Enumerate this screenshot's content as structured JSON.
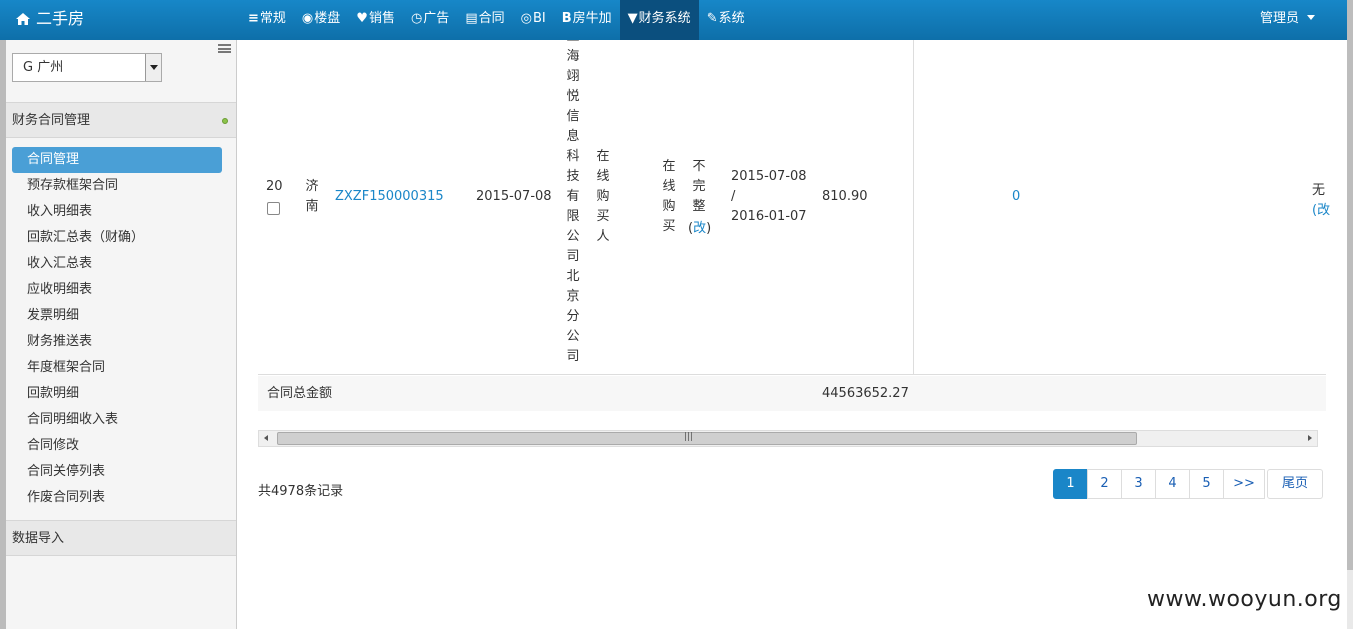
{
  "topbar": {
    "brand": "二手房",
    "nav": [
      {
        "icon": "≡",
        "label": "常规"
      },
      {
        "icon": "◉",
        "label": "楼盘"
      },
      {
        "icon": "♥",
        "label": "销售"
      },
      {
        "icon": "◷",
        "label": "广告"
      },
      {
        "icon": "▤",
        "label": "合同"
      },
      {
        "icon": "◎",
        "label": "BI"
      },
      {
        "icon": "B",
        "label": "房牛加"
      },
      {
        "icon": "▼",
        "label": "财务系统"
      },
      {
        "icon": "✎",
        "label": "系统"
      }
    ],
    "active_nav": "财务系统",
    "user": "管理员"
  },
  "sidebar": {
    "city_select": "G 广州",
    "section1": "财务合同管理",
    "menu": [
      "合同管理",
      "预存款框架合同",
      "收入明细表",
      "回款汇总表（财确）",
      "收入汇总表",
      "应收明细表",
      "发票明细",
      "财务推送表",
      "年度框架合同",
      "回款明细",
      "合同明细收入表",
      "合同修改",
      "合同关停列表",
      "作废合同列表"
    ],
    "active_menu": "合同管理",
    "section2": "数据导入"
  },
  "row": {
    "index": "20",
    "city": [
      "济",
      "南"
    ],
    "contract_no": "ZXZF150000315",
    "date": "2015-07-08",
    "company": [
      "上",
      "海",
      "翊",
      "悦",
      "信",
      "息",
      "科",
      "技",
      "有",
      "限",
      "公",
      "司",
      "北",
      "京",
      "分",
      "公",
      "司"
    ],
    "buyer_type": [
      "在",
      "线",
      "购",
      "买",
      "人"
    ],
    "channel": [
      "在",
      "线",
      "购",
      "买"
    ],
    "status": [
      "不",
      "完",
      "整"
    ],
    "edit_paren_open": "(",
    "edit_link": "改",
    "edit_paren_close": ")",
    "period_start": "2015-07-08",
    "period_sep": "/",
    "period_end": "2016-01-07",
    "amount": "810.90",
    "count_link": "0",
    "extra": "无",
    "extra_edit": "(改"
  },
  "total": {
    "label": "合同总金额",
    "value": "44563652.27"
  },
  "footer": {
    "record_count": "共4978条记录",
    "pages": [
      "1",
      "2",
      "3",
      "4",
      "5"
    ],
    "active_page": "1",
    "next": ">>",
    "last": "尾页"
  },
  "watermark": "www.wooyun.org"
}
